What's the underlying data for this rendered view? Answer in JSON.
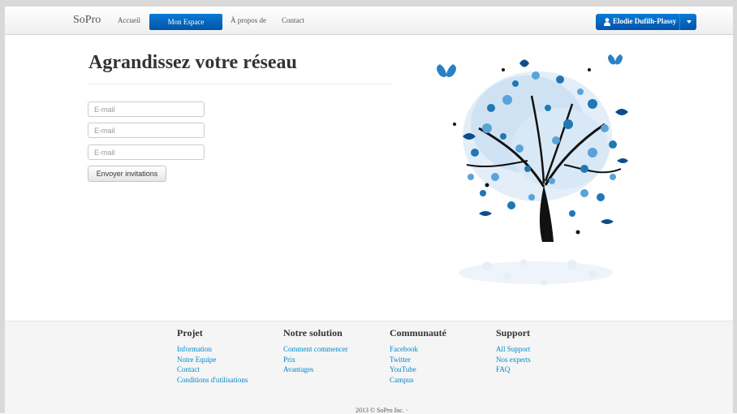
{
  "nav": {
    "brand": "SoPro",
    "links": [
      "Accueil",
      "Mon Espace",
      "À propos de",
      "Contact"
    ],
    "active": "Mon Espace",
    "user": "Elodie Dufilh-Plassy",
    "accent": "#0a66c2"
  },
  "main": {
    "title": "Agrandissez votre réseau",
    "email_placeholder": "E-mail",
    "send_label": "Envoyer invitations",
    "illustration": "blue-tree-illustration"
  },
  "footer": {
    "columns": [
      {
        "title": "Projet",
        "links": [
          "Information",
          "Notre Equipe",
          "Contact",
          "Conditions d'utilisations"
        ]
      },
      {
        "title": "Notre solution",
        "links": [
          "Comment commencer",
          "Prix",
          "Avantages"
        ]
      },
      {
        "title": "Communauté",
        "links": [
          "Facebook",
          "Twitter",
          "YouTube",
          "Campus"
        ]
      },
      {
        "title": "Support",
        "links": [
          "All Support",
          "Nos experts",
          "FAQ"
        ]
      }
    ],
    "copyright": "2013 © SoPro Inc. ·"
  }
}
